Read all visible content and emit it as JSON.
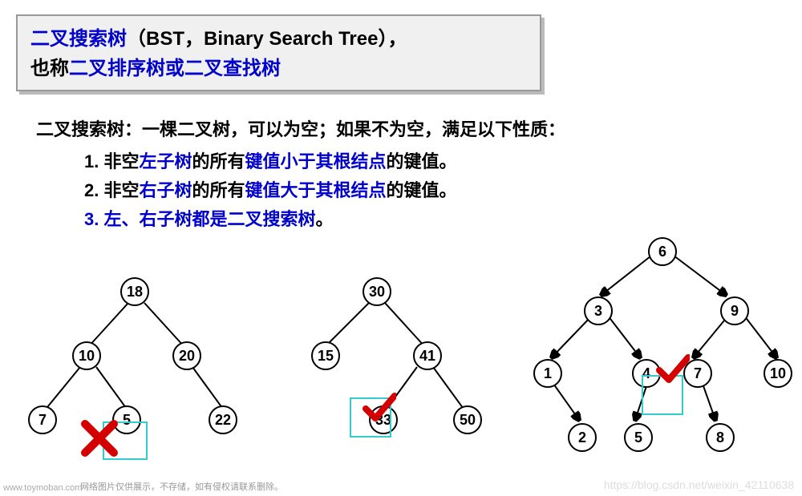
{
  "title": {
    "line1": {
      "part1": "二叉搜索树",
      "part2": "（BST，Binary Search Tree），"
    },
    "line2": {
      "part1": "也称",
      "part2": "二叉排序树或二叉查找树"
    }
  },
  "definition": "二叉搜索树：一棵二叉树，可以为空；如果不为空，满足以下性质：",
  "props": {
    "p1": {
      "num": "1. ",
      "a": "非空",
      "b": "左子树",
      "c": "的所有",
      "d": "键值小于其根结点",
      "e": "的键值。"
    },
    "p2": {
      "num": "2. ",
      "a": "非空",
      "b": "右子树",
      "c": "的所有",
      "d": "键值大于其根结点",
      "e": "的键值。"
    },
    "p3": {
      "num": "3. ",
      "a": "左、右子树都是二叉搜索树",
      "b": "。"
    }
  },
  "tree1": {
    "n0": "18",
    "n1": "10",
    "n2": "20",
    "n3": "7",
    "n4": "5",
    "n5": "22",
    "marker": "cross"
  },
  "tree2": {
    "n0": "30",
    "n1": "15",
    "n2": "41",
    "n3": "33",
    "n4": "50",
    "marker": "check"
  },
  "tree3": {
    "n0": "6",
    "n1": "3",
    "n2": "9",
    "n3": "1",
    "n4": "4",
    "n5": "7",
    "n6": "10",
    "n7": "2",
    "n8": "5",
    "n9": "8",
    "marker": "check"
  },
  "watermarks": {
    "toymoban": "www.toymoban.com",
    "bottom": "网络图片仅供展示，不存储，如有侵权请联系删除。",
    "csdn": "https://blog.csdn.net/weixin_42110638"
  },
  "colors": {
    "blue": "#0000cc",
    "red": "#d40000",
    "black": "#000000",
    "cyan": "#33cccc"
  }
}
